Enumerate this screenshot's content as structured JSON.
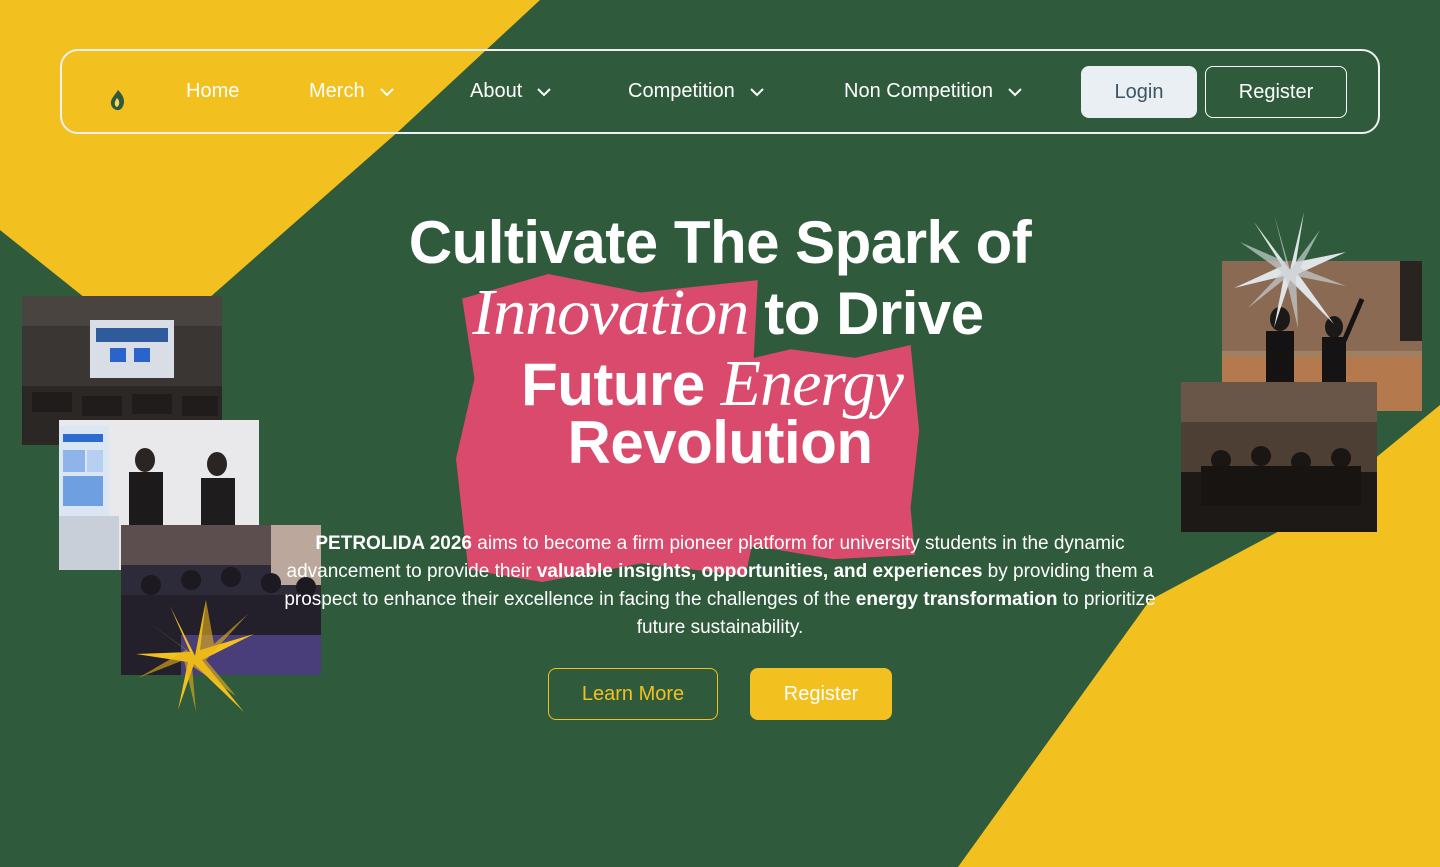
{
  "brand": {
    "logo_icon": "flame-drop-logo-icon",
    "colors": {
      "green": "#2f5b3c",
      "yellow": "#f2c01f",
      "pink": "#d94a6c",
      "light": "#e9eff3"
    }
  },
  "nav": {
    "items": [
      {
        "label": "Home",
        "dropdown": false
      },
      {
        "label": "Merch",
        "dropdown": true
      },
      {
        "label": "About",
        "dropdown": true
      },
      {
        "label": "Competition",
        "dropdown": true
      },
      {
        "label": "Non Competition",
        "dropdown": true
      }
    ],
    "login_label": "Login",
    "register_label": "Register"
  },
  "hero": {
    "line1": "Cultivate The Spark of",
    "tag1": "Innovation",
    "line2_rest": "to Drive",
    "line3_start": "Future",
    "tag2": "Energy",
    "line4": "Revolution",
    "desc": {
      "p1_bold": "PETROLIDA 2026",
      "p2": " aims to become a firm pioneer platform for university students in the dynamic advancement to provide their ",
      "p3_bold": "valuable insights, opportunities, and experiences",
      "p4": " by providing them a prospect to enhance their excellence in facing the challenges of the ",
      "p5_bold": "energy transformation",
      "p6": " to prioritize future sustainability."
    },
    "learn_more_label": "Learn More",
    "register_label": "Register"
  },
  "decor": {
    "photos": [
      "auditorium-photo",
      "presentation-photo",
      "group-photo-left",
      "stage-photo",
      "group-photo-right"
    ],
    "stars": [
      "yellow-star-icon",
      "white-star-icon"
    ]
  }
}
